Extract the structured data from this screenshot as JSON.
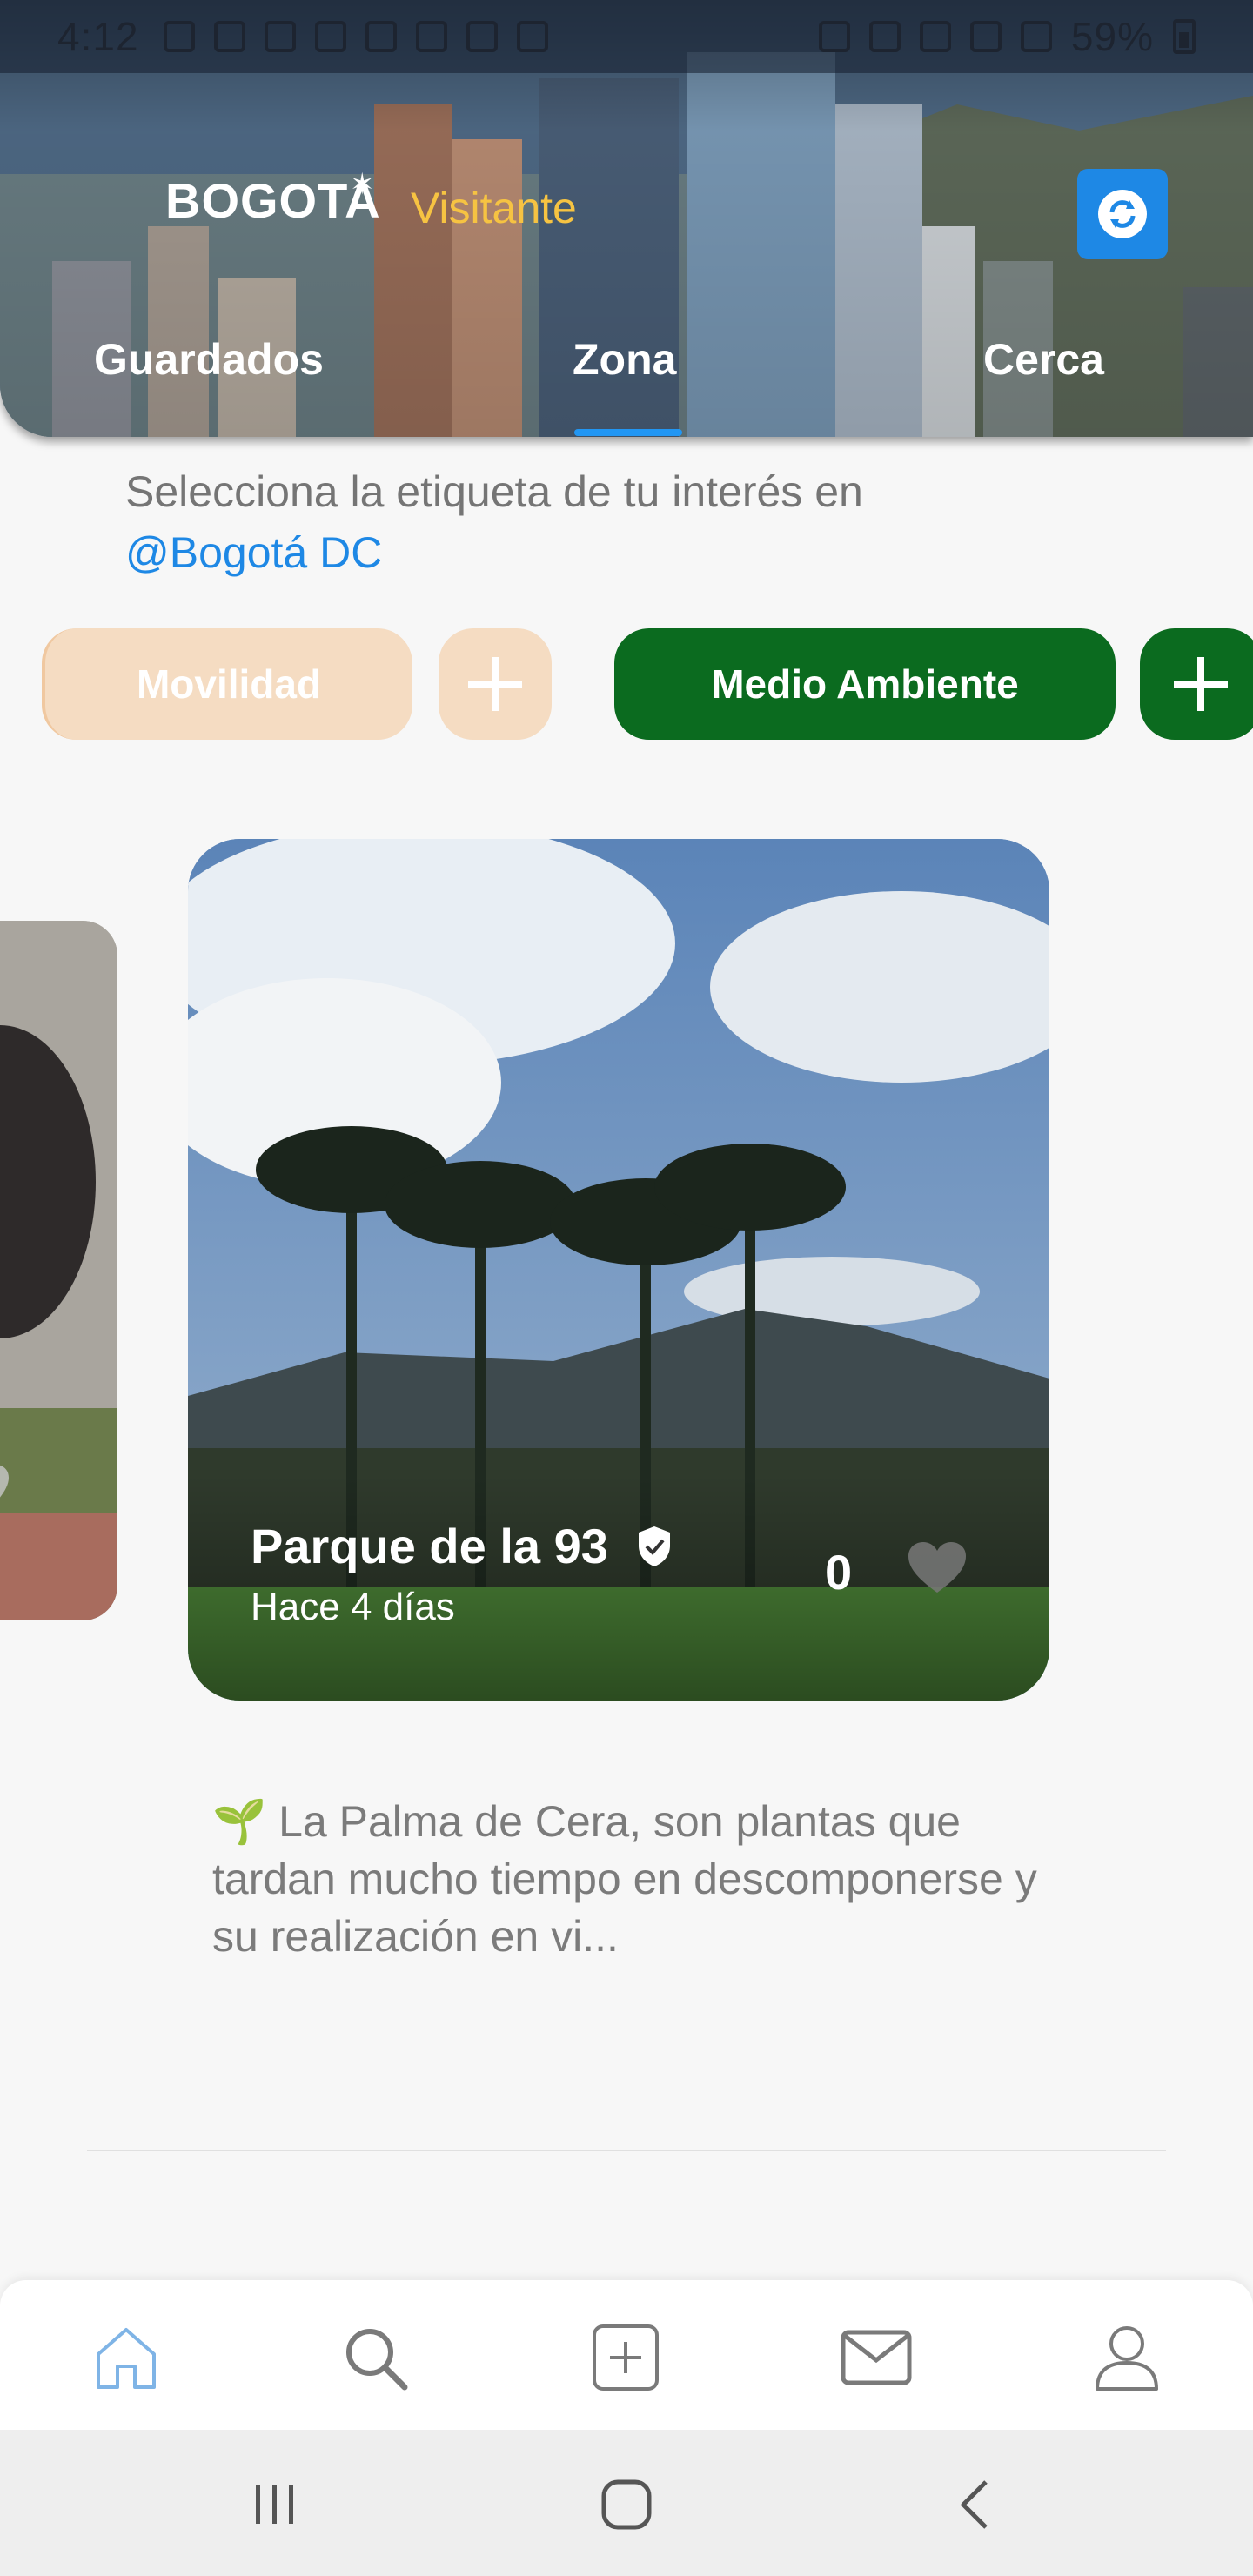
{
  "status_bar": {
    "time": "4:12",
    "battery": "59%"
  },
  "header": {
    "logo": "BOGOTA",
    "role": "Visitante",
    "tabs": [
      {
        "label": "Guardados",
        "active": false
      },
      {
        "label": "Zona",
        "active": true
      },
      {
        "label": "Cerca",
        "active": false
      }
    ],
    "accent_color": "#2196f3"
  },
  "intro": {
    "text": "Selecciona la etiqueta de tu interés en",
    "link": "@Bogotá DC"
  },
  "tags": [
    {
      "label": "Movilidad",
      "selected": false,
      "color": "#f5dcc2"
    },
    {
      "label": "Medio Ambiente",
      "selected": true,
      "color": "#0b6b1f"
    }
  ],
  "card": {
    "title": "Parque de la 93",
    "time": "Hace 4 días",
    "likes": "0",
    "verified_icon": "verified-badge-icon",
    "like_icon": "heart-icon"
  },
  "description": "🌱 La Palma de Cera, son plantas que tardan mucho tiempo en descomponerse y su realización en vi...",
  "bottom_nav": {
    "items": [
      "home-icon",
      "search-icon",
      "add-icon",
      "mail-icon",
      "profile-icon"
    ],
    "active": "home-icon"
  },
  "system_nav": [
    "recent-apps-icon",
    "home-button-icon",
    "back-icon"
  ]
}
